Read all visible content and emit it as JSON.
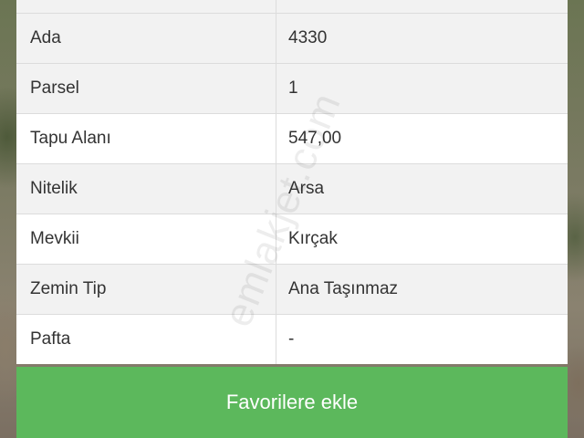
{
  "details": {
    "rows": [
      {
        "label": "",
        "value": ""
      },
      {
        "label": "Ada",
        "value": "4330"
      },
      {
        "label": "Parsel",
        "value": "1"
      },
      {
        "label": "Tapu Alanı",
        "value": "547,00"
      },
      {
        "label": "Nitelik",
        "value": "Arsa"
      },
      {
        "label": "Mevkii",
        "value": "Kırçak"
      },
      {
        "label": "Zemin Tip",
        "value": "Ana Taşınmaz"
      },
      {
        "label": "Pafta",
        "value": "-"
      }
    ]
  },
  "actions": {
    "favorite_label": "Favorilere ekle",
    "favorite_color": "#5cb85c"
  },
  "watermark": "emlakjet.com"
}
